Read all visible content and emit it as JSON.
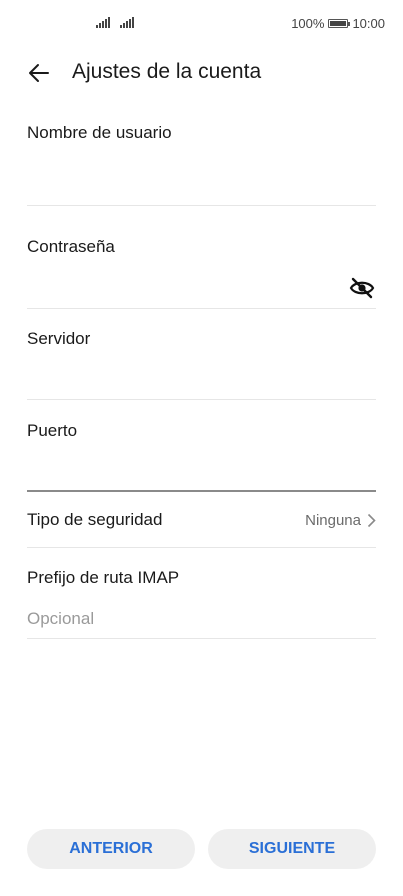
{
  "status_bar": {
    "battery": "100%",
    "time": "10:00"
  },
  "header": {
    "title": "Ajustes de la cuenta"
  },
  "form": {
    "username_label": "Nombre de usuario",
    "password_label": "Contraseña",
    "server_label": "Servidor",
    "port_label": "Puerto",
    "security_label": "Tipo de seguridad",
    "security_value": "Ninguna",
    "imap_label": "Prefijo de ruta IMAP",
    "imap_placeholder": "Opcional"
  },
  "buttons": {
    "previous": "ANTERIOR",
    "next": "SIGUIENTE"
  },
  "colors": {
    "accent": "#2a6fd6",
    "button_bg": "#efefef"
  },
  "icons": [
    "signal-icon",
    "battery-icon",
    "back-arrow-icon",
    "eye-off-icon",
    "chevron-right-icon"
  ]
}
